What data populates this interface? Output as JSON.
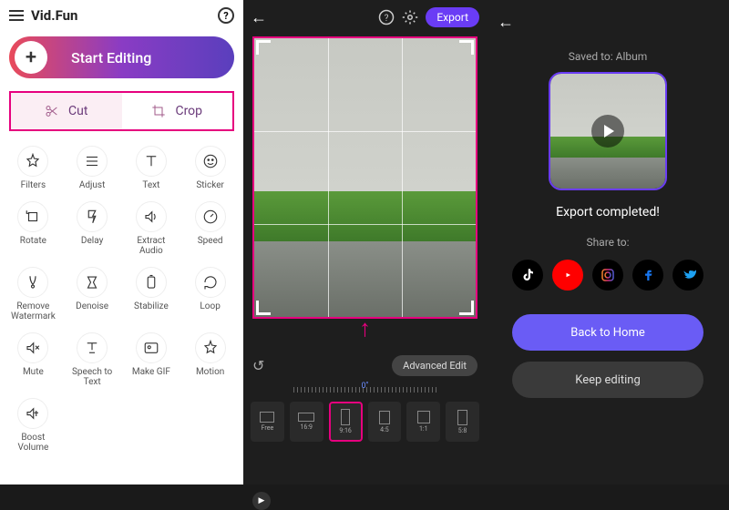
{
  "left": {
    "app_name": "Vid.Fun",
    "start_label": "Start Editing",
    "cut_label": "Cut",
    "crop_label": "Crop",
    "tools": [
      {
        "id": "filters",
        "label": "Filters"
      },
      {
        "id": "adjust",
        "label": "Adjust"
      },
      {
        "id": "text",
        "label": "Text"
      },
      {
        "id": "sticker",
        "label": "Sticker"
      },
      {
        "id": "rotate",
        "label": "Rotate"
      },
      {
        "id": "delay",
        "label": "Delay"
      },
      {
        "id": "extract-audio",
        "label": "Extract\nAudio"
      },
      {
        "id": "speed",
        "label": "Speed"
      },
      {
        "id": "remove-watermark",
        "label": "Remove\nWatermark"
      },
      {
        "id": "denoise",
        "label": "Denoise"
      },
      {
        "id": "stabilize",
        "label": "Stabilize"
      },
      {
        "id": "loop",
        "label": "Loop"
      },
      {
        "id": "mute",
        "label": "Mute"
      },
      {
        "id": "speech-to-text",
        "label": "Speech to\nText"
      },
      {
        "id": "make-gif",
        "label": "Make GIF"
      },
      {
        "id": "motion",
        "label": "Motion"
      },
      {
        "id": "boost-volume",
        "label": "Boost\nVolume"
      }
    ]
  },
  "mid": {
    "export_label": "Export",
    "advanced_label": "Advanced Edit",
    "time_marker": "0\"",
    "ratios": [
      {
        "id": "free",
        "label": "Free",
        "w": 16,
        "h": 12
      },
      {
        "id": "16-9",
        "label": "16:9",
        "w": 18,
        "h": 10
      },
      {
        "id": "9-16",
        "label": "9:16",
        "w": 10,
        "h": 18,
        "selected": true
      },
      {
        "id": "4-5",
        "label": "4:5",
        "w": 12,
        "h": 15
      },
      {
        "id": "1-1",
        "label": "1:1",
        "w": 14,
        "h": 14
      },
      {
        "id": "5-8",
        "label": "5:8",
        "w": 11,
        "h": 17
      }
    ]
  },
  "right": {
    "saved_label": "Saved to: Album",
    "done_label": "Export completed!",
    "share_label": "Share to:",
    "home_label": "Back to Home",
    "keep_label": "Keep editing",
    "share_targets": [
      {
        "id": "tiktok",
        "bg": "#000"
      },
      {
        "id": "youtube",
        "bg": "#ff0000"
      },
      {
        "id": "instagram",
        "bg": "#000"
      },
      {
        "id": "facebook",
        "bg": "#000"
      },
      {
        "id": "twitter",
        "bg": "#000"
      }
    ]
  }
}
